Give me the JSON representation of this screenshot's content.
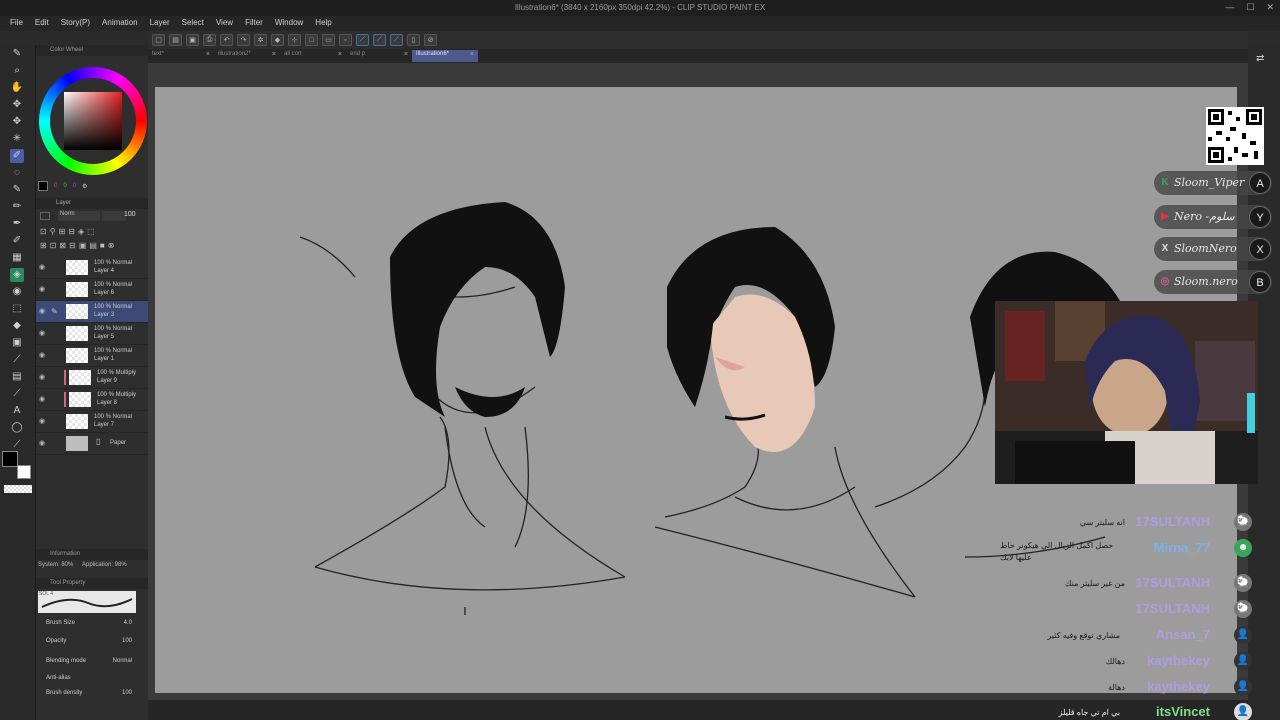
{
  "window": {
    "title": "Illustration6* (3840 x 2160px 350dpi 42.2%) - CLIP STUDIO PAINT EX"
  },
  "menu": [
    "File",
    "Edit",
    "Story(P)",
    "Animation",
    "Layer",
    "Select",
    "View",
    "Filter",
    "Window",
    "Help"
  ],
  "tabs": [
    {
      "label": "text*",
      "active": false
    },
    {
      "label": "illustration2*",
      "active": false
    },
    {
      "label": "all cort",
      "active": false
    },
    {
      "label": "end p",
      "active": false
    },
    {
      "label": "Illustration6*",
      "active": true
    }
  ],
  "color_panel": {
    "title": "Color Wheel",
    "values": [
      "0",
      "0",
      "0"
    ],
    "main_color": "#000000"
  },
  "layer_panel": {
    "title": "Layer",
    "blend": "Norm",
    "opacity": "100",
    "layers": [
      {
        "mode": "100 % Normal",
        "name": "Layer 4",
        "selected": false,
        "mark": false
      },
      {
        "mode": "100 % Normal",
        "name": "Layer 6",
        "selected": false,
        "mark": false
      },
      {
        "mode": "100 % Normal",
        "name": "Layer 3",
        "selected": true,
        "mark": false
      },
      {
        "mode": "100 % Normal",
        "name": "Layer 5",
        "selected": false,
        "mark": false
      },
      {
        "mode": "100 % Normal",
        "name": "Layer 1",
        "selected": false,
        "mark": false
      },
      {
        "mode": "100 % Multiply",
        "name": "Layer 9",
        "selected": false,
        "mark": true
      },
      {
        "mode": "100 % Multiply",
        "name": "Layer 8",
        "selected": false,
        "mark": true
      },
      {
        "mode": "100 % Normal",
        "name": "Layer 7",
        "selected": false,
        "mark": false
      },
      {
        "mode": "",
        "name": "Paper",
        "selected": false,
        "mark": false
      }
    ]
  },
  "info_panel": {
    "title": "Information",
    "system": "System: 80%",
    "application": "Application: 98%"
  },
  "tool_property": {
    "title": "Tool Property",
    "brush_name": "SOL 4",
    "brush_size_label": "Brush Size",
    "brush_size": "4.0",
    "opacity_label": "Opacity",
    "opacity": "100",
    "blending_label": "Blending mode",
    "blending": "Normal",
    "antialias_label": "Anti-alias",
    "density_label": "Brush density",
    "density": "100"
  },
  "socials": [
    {
      "icon": "K",
      "text": "Sloom_Viper",
      "badge": "A",
      "color": "#3aa65a"
    },
    {
      "icon": "▶",
      "text": "Nero -سلوم",
      "badge": "Y",
      "color": "#e2314f"
    },
    {
      "icon": "X",
      "text": "SloomNero",
      "badge": "X",
      "color": "#e0e0e0"
    },
    {
      "icon": "◎",
      "text": "Sloom.nero",
      "badge": "B",
      "color": "#d35b9a"
    }
  ],
  "chat": [
    {
      "user": "17SULTANH",
      "text": "انه سلبتر سي",
      "color": "#b09be0",
      "avatar": "🐑"
    },
    {
      "user": "Mirna_77",
      "text": "حصل اكمل الزيال الي هيكونر حاط عليها لابك",
      "color": "#7fb0e8",
      "avatar": "☻"
    },
    {
      "user": "17SULTANH",
      "text": "من غير سلبتر منك",
      "color": "#b09be0",
      "avatar": "🐑"
    },
    {
      "user": "17SULTANH",
      "text": "",
      "color": "#b09be0",
      "avatar": "🐑"
    },
    {
      "user": "Ansan_7",
      "text": "مشاري توقع وفيه كثير",
      "color": "#b09be0",
      "avatar": "👤"
    },
    {
      "user": "kaythekey",
      "text": "دهالك",
      "color": "#b09be0",
      "avatar": "👤"
    },
    {
      "user": "kaythekey",
      "text": "دهالة",
      "color": "#b09be0",
      "avatar": "👤"
    },
    {
      "user": "itsVincet",
      "text": "بي ام تي جاه قليلز",
      "color": "#7fe08a",
      "avatar": "👤"
    }
  ]
}
